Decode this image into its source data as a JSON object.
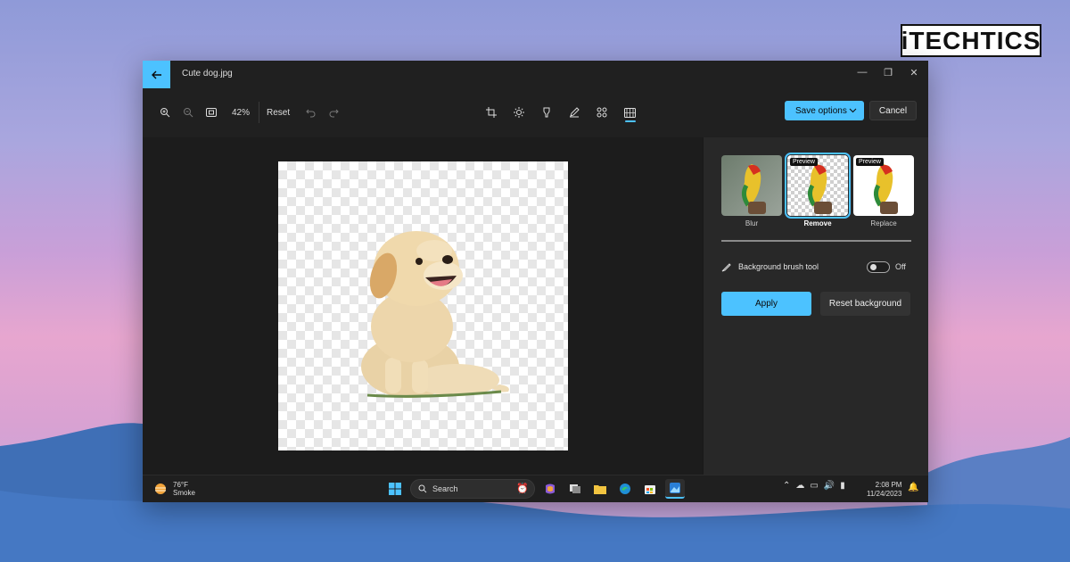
{
  "brand": {
    "text": "iTECHTICS"
  },
  "window": {
    "title": "Cute dog.jpg",
    "controls": {
      "minimize": "—",
      "maximize": "❐",
      "close": "✕"
    }
  },
  "toolbar": {
    "zoom_level": "42%",
    "reset_label": "Reset",
    "save_label": "Save options",
    "cancel_label": "Cancel"
  },
  "panel": {
    "options": [
      {
        "label": "Blur",
        "preview": ""
      },
      {
        "label": "Remove",
        "preview": "Preview"
      },
      {
        "label": "Replace",
        "preview": "Preview"
      }
    ],
    "selected": "Remove",
    "brush_label": "Background brush tool",
    "toggle_state": "Off",
    "apply_label": "Apply",
    "reset_bg_label": "Reset background"
  },
  "taskbar": {
    "weather_temp": "76°F",
    "weather_cond": "Smoke",
    "search_placeholder": "Search",
    "time": "2:08 PM",
    "date": "11/24/2023"
  },
  "colors": {
    "accent": "#4cc2ff",
    "window_bg": "#202020",
    "panel_bg": "#282828"
  }
}
